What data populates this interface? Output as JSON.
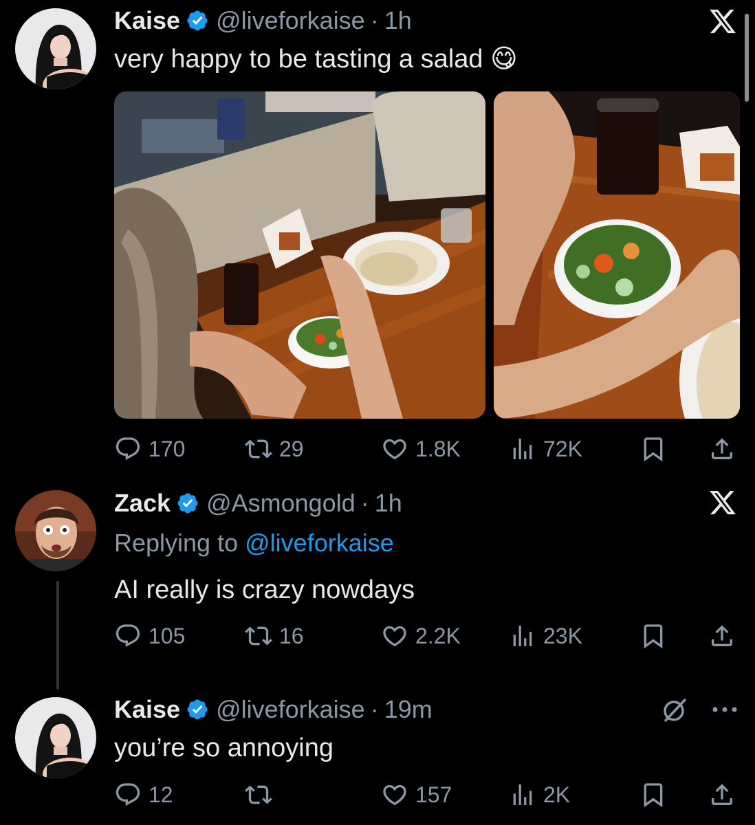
{
  "tweets": [
    {
      "name": "Kaise",
      "handle": "@liveforkaise",
      "separator": "·",
      "time": "1h",
      "text": "very happy to be tasting a salad 😋",
      "media": [
        "photo",
        "photo"
      ],
      "stats": {
        "replies": "170",
        "reposts": "29",
        "likes": "1.8K",
        "views": "72K"
      },
      "icons": {
        "reply": "reply-icon",
        "repost": "repost-icon",
        "like": "heart-icon",
        "views": "views-chart-icon",
        "bookmark": "bookmark-icon",
        "share": "share-icon"
      }
    },
    {
      "name": "Zack",
      "handle": "@Asmongold",
      "separator": "·",
      "time": "1h",
      "replying_prefix": "Replying to",
      "replying_to": "@liveforkaise",
      "text": "AI really is crazy nowdays",
      "stats": {
        "replies": "105",
        "reposts": "16",
        "likes": "2.2K",
        "views": "23K"
      }
    },
    {
      "name": "Kaise",
      "handle": "@liveforkaise",
      "separator": "·",
      "time": "19m",
      "text": "you’re so annoying",
      "stats": {
        "replies": "12",
        "reposts": "",
        "likes": "157",
        "views": "2K"
      }
    }
  ],
  "icons": {
    "x_logo": "x-logo-icon",
    "grok": "grok-icon",
    "more": "more-icon",
    "verified": "verified-badge-icon"
  },
  "colors": {
    "background": "#000000",
    "text": "#e7e9ea",
    "secondary": "#8b98a5",
    "accent": "#1d9bf0"
  }
}
